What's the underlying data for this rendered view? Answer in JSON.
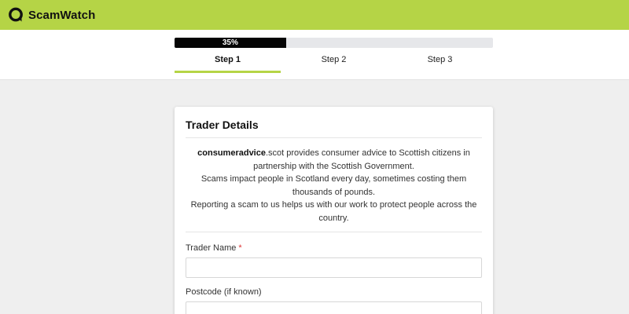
{
  "brand": {
    "name": "ScamWatch",
    "accent_color": "#b5d446",
    "logo_icon": "speech-bubble-ring-icon"
  },
  "progress": {
    "percent": 35,
    "label": "35%"
  },
  "steps": [
    {
      "label": "Step 1",
      "active": true
    },
    {
      "label": "Step 2",
      "active": false
    },
    {
      "label": "Step 3",
      "active": false
    }
  ],
  "form": {
    "title": "Trader Details",
    "intro": {
      "brand_bold": "consumeradvice",
      "brand_suffix": ".scot provides consumer advice to Scottish citizens in partnership with the Scottish Government.",
      "line2": "Scams impact people in Scotland every day, sometimes costing them thousands of pounds.",
      "line3": "Reporting a scam to us helps us with our work to protect people across the country."
    },
    "fields": [
      {
        "label": "Trader Name",
        "required_mark": "*",
        "value": "",
        "placeholder": ""
      },
      {
        "label": "Postcode (if known)",
        "value": "",
        "placeholder": ""
      }
    ]
  }
}
